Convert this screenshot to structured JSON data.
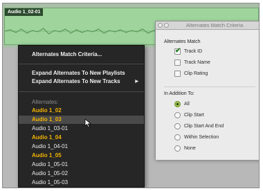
{
  "clip": {
    "name": "Audio 1_02-01"
  },
  "menu": {
    "items": [
      {
        "label": "Alternates Match Criteria..."
      },
      {
        "label": "Expand Alternates To New Playlists"
      },
      {
        "label": "Expand Alternates To New Tracks",
        "has_submenu": true
      }
    ],
    "alternates_header": "Alternates:",
    "alternates": [
      {
        "label": "Audio 1_02",
        "state": "active"
      },
      {
        "label": "Audio 1_03",
        "state": "active-hover"
      },
      {
        "label": "Audio 1_03-01",
        "state": "normal"
      },
      {
        "label": "Audio 1_04",
        "state": "active"
      },
      {
        "label": "Audio 1_04-01",
        "state": "normal"
      },
      {
        "label": "Audio 1_05",
        "state": "active"
      },
      {
        "label": "Audio 1_05-01",
        "state": "normal"
      },
      {
        "label": "Audio 1_05-02",
        "state": "normal"
      },
      {
        "label": "Audio 1_05-03",
        "state": "normal"
      }
    ],
    "submenu_arrow": "▶"
  },
  "criteria_window": {
    "title": "Alternates Match Criteria",
    "match_label": "Alternates Match",
    "match_options": [
      {
        "label": "Track ID",
        "checked": true
      },
      {
        "label": "Track Name",
        "checked": false
      },
      {
        "label": "Clip Rating",
        "checked": false
      }
    ],
    "addition_label": "In Addition To:",
    "addition_options": [
      {
        "label": "All",
        "selected": true
      },
      {
        "label": "Clip Start",
        "selected": false
      },
      {
        "label": "Clip Start And End",
        "selected": false
      },
      {
        "label": "Within Selection",
        "selected": false
      },
      {
        "label": "None",
        "selected": false
      }
    ]
  },
  "colors": {
    "menu_bg": "#262626",
    "active_alternate": "#f4b400",
    "clip_fill": "#9fd49d",
    "clip_name_bg": "#2c4a2e",
    "radio_selected": "#9fc14d",
    "checkmark": "#1b7a1b"
  },
  "icons": {
    "check": "check-icon",
    "pointer": "arrow-cursor-icon"
  }
}
